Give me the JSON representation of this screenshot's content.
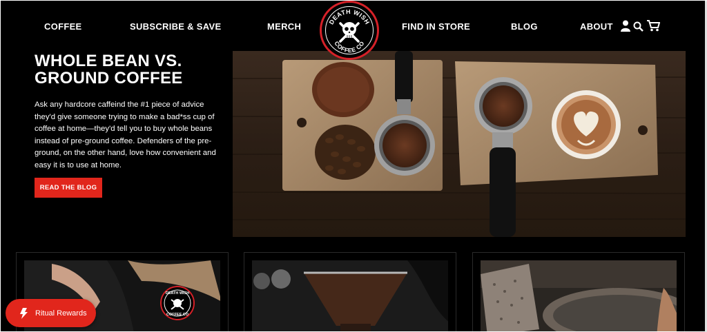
{
  "nav": {
    "links": [
      "COFFEE",
      "SUBSCRIBE & SAVE",
      "MERCH",
      "FIND IN STORE",
      "BLOG",
      "ABOUT"
    ],
    "logo": {
      "top": "DEATH WISH",
      "bottom": "COFFEE CO"
    },
    "icons": [
      "user-icon",
      "search-icon",
      "cart-icon"
    ]
  },
  "hero": {
    "title_line1": "WHOLE BEAN VS.",
    "title_line2": "GROUND COFFEE",
    "body": "Ask any hardcore caffeind the #1 piece of advice they'd give someone trying to make a bad*ss cup of coffee at home—they'd tell you to buy whole beans instead of pre-ground coffee. Defenders of the pre-ground, on the other hand, love how convenient and easy it is to use at home.",
    "cta_label": "READ THE BLOG"
  },
  "cards": [
    {
      "name": "card-shirt",
      "badge_top": "DEATH WISH",
      "badge_bottom": "COFFEE CO"
    },
    {
      "name": "card-pourover"
    },
    {
      "name": "card-roaster"
    }
  ],
  "rewards": {
    "label": "Ritual Rewards"
  },
  "colors": {
    "accent": "#e1261c",
    "background": "#000000",
    "text": "#ffffff"
  }
}
